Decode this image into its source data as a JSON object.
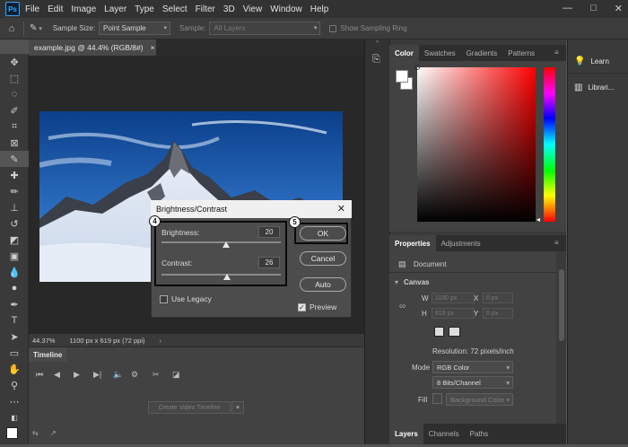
{
  "app": {
    "logo_text": "Ps",
    "menu": [
      "File",
      "Edit",
      "Image",
      "Layer",
      "Type",
      "Select",
      "Filter",
      "3D",
      "View",
      "Window",
      "Help"
    ],
    "window_controls": [
      "—",
      "□",
      "✕"
    ]
  },
  "options_bar": {
    "sample_size_label": "Sample Size:",
    "sample_size_value": "Point Sample",
    "sample_label": "Sample:",
    "sample_value": "All Layers",
    "sampling_ring_label": "Show Sampling Ring"
  },
  "document": {
    "tab_title": "example.jpg @ 44.4% (RGB/8#)",
    "tab_close": "×",
    "zoom": "44.37%",
    "dimensions": "1100 px x 619 px (72 ppi)"
  },
  "timeline": {
    "tab_label": "Timeline",
    "create_button": "Create Video Timeline"
  },
  "dialog": {
    "title": "Brightness/Contrast",
    "brightness_label": "Brightness:",
    "brightness_value": "20",
    "brightness_level": 0.54,
    "contrast_label": "Contrast:",
    "contrast_value": "26",
    "contrast_level": 0.55,
    "ok_label": "OK",
    "cancel_label": "Cancel",
    "auto_label": "Auto",
    "use_legacy_label": "Use Legacy",
    "use_legacy_checked": false,
    "preview_label": "Preview",
    "preview_checked": true,
    "badge_sliders": "4",
    "badge_ok": "5"
  },
  "color_panel": {
    "tabs": [
      "Color",
      "Swatches",
      "Gradients",
      "Patterns"
    ],
    "active_tab": 0
  },
  "properties_panel": {
    "tabs": [
      "Properties",
      "Adjustments"
    ],
    "active_tab": 0,
    "document_label": "Document",
    "canvas_label": "Canvas",
    "w_label": "W",
    "w_value": "1100 px",
    "x_label": "X",
    "x_value": "0 px",
    "h_label": "H",
    "h_value": "619 px",
    "y_label": "Y",
    "y_value": "0 px",
    "resolution": "Resolution: 72 pixels/inch",
    "mode_label": "Mode",
    "mode_value": "RGB Color",
    "bits_value": "8 Bits/Channel",
    "fill_label": "Fill",
    "fill_value": "Background Color"
  },
  "layers_panel": {
    "tabs": [
      "Layers",
      "Channels",
      "Paths"
    ],
    "active_tab": 0
  },
  "learn_column": {
    "items": [
      "Learn",
      "Librari..."
    ]
  },
  "colors": {
    "menubar_bg": "#323232",
    "panel_bg": "#424242",
    "canvas_bg": "#282828",
    "accent_blue": "#31a8ff",
    "foreground_swatch": "#ffffff",
    "background_swatch": "#ffffff"
  }
}
